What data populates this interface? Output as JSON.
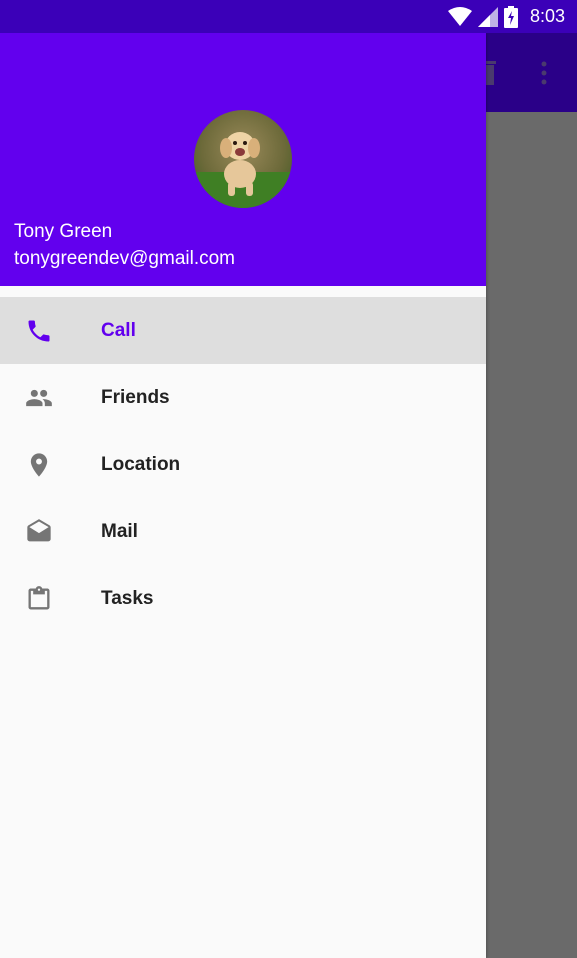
{
  "status_bar": {
    "time": "8:03"
  },
  "drawer": {
    "header": {
      "avatar": "puppy-photo",
      "user_name": "Tony Green",
      "user_email": "tonygreendev@gmail.com"
    },
    "menu": [
      {
        "label": "Call",
        "icon": "phone-icon",
        "selected": true
      },
      {
        "label": "Friends",
        "icon": "people-icon",
        "selected": false
      },
      {
        "label": "Location",
        "icon": "location-pin-icon",
        "selected": false
      },
      {
        "label": "Mail",
        "icon": "mail-icon",
        "selected": false
      },
      {
        "label": "Tasks",
        "icon": "clipboard-icon",
        "selected": false
      }
    ]
  },
  "colors": {
    "status_bar": "#3b00b8",
    "header": "#6200ee",
    "accent": "#6200ee",
    "scrim": "#6a6a6a"
  }
}
